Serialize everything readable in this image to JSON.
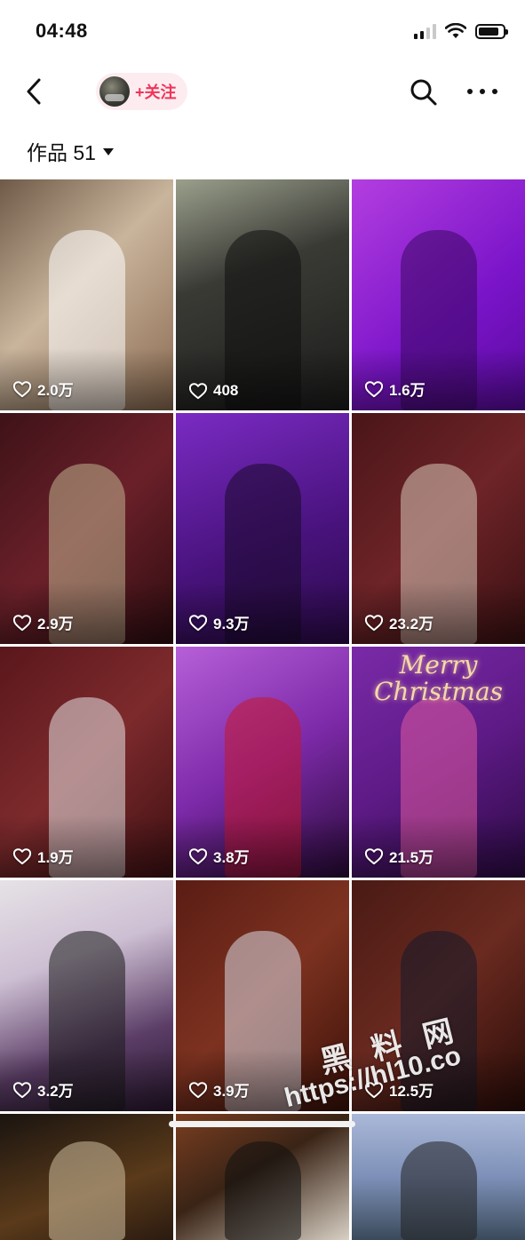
{
  "status_bar": {
    "time": "04:48"
  },
  "nav": {
    "follow_label": "+关注"
  },
  "section": {
    "works_label": "作品 51"
  },
  "tiles": [
    {
      "likes": "2.0万",
      "bg": "linear-gradient(135deg,#6f5a48 0%,#c9b49c 45%,#8a6a50 100%)",
      "fig": "#ffffff"
    },
    {
      "likes": "408",
      "bg": "linear-gradient(160deg,#9aa08c 0%,#3a3a35 40%,#1b1b1b 100%)",
      "fig": "#0e0e0e"
    },
    {
      "likes": "1.6万",
      "bg": "linear-gradient(140deg,#b33ee0 0%,#7a14c9 60%,#5a0aa0 100%)",
      "fig": "#3a0860"
    },
    {
      "likes": "2.9万",
      "bg": "linear-gradient(135deg,#3e1218 0%,#6b2029 50%,#2d0c10 100%)",
      "fig": "#bfb38f"
    },
    {
      "likes": "9.3万",
      "bg": "linear-gradient(160deg,#7b2bc4 0%,#4a137f 55%,#2b0a4a 100%)",
      "fig": "#1a0a2a"
    },
    {
      "likes": "23.2万",
      "bg": "linear-gradient(135deg,#4a1518 0%,#6e2428 50%,#3a1012 100%)",
      "fig": "#d9c9b9"
    },
    {
      "likes": "1.9万",
      "bg": "linear-gradient(135deg,#5a171c 0%,#7d2a2c 50%,#3f1013 100%)",
      "fig": "#e6e3e6"
    },
    {
      "likes": "3.8万",
      "bg": "linear-gradient(150deg,#b65fd8 0%,#7d2aa9 50%,#2a0a3a 100%)",
      "fig": "#c4162a"
    },
    {
      "likes": "21.5万",
      "bg": "linear-gradient(150deg,#7a2aa8 0%,#5e1a86 50%,#2d0a45 100%)",
      "fig": "#e05aa0",
      "overlay": "Merry Christmas"
    },
    {
      "likes": "3.2万",
      "bg": "linear-gradient(160deg,#e6e2e6 0%,#cdbfd3 35%,#5b3d66 70%,#2a1830 100%)",
      "fig": "#1a1a1a"
    },
    {
      "likes": "3.9万",
      "bg": "linear-gradient(135deg,#5a1c14 0%,#7d3220 50%,#3a1008 100%)",
      "fig": "#d8dbe6"
    },
    {
      "likes": "12.5万",
      "bg": "linear-gradient(135deg,#4a1a14 0%,#6a2a20 50%,#2a0c08 100%)",
      "fig": "#121a2a"
    },
    {
      "likes": "",
      "bg": "linear-gradient(160deg,#1a1410 0%,#5a3a1a 60%,#2a1a10 100%)",
      "fig": "#d0c0a0"
    },
    {
      "likes": "",
      "bg": "linear-gradient(150deg,#7a3e20 0%,#3a2416 45%,#d8d0c4 100%)",
      "fig": "#101010"
    },
    {
      "likes": "",
      "bg": "linear-gradient(180deg,#aab8d8 0%,#7e90b8 50%,#3a4a5a 100%)",
      "fig": "#202020"
    }
  ],
  "watermark": {
    "line1": "黑 料 网",
    "line2": "https://hl10.co"
  }
}
